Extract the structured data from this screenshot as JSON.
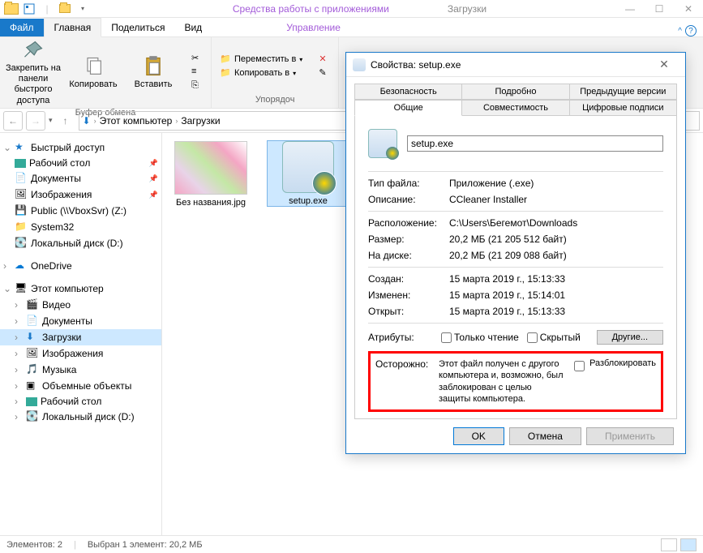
{
  "titlebar": {
    "context_tab": "Средства работы с приложениями",
    "location": "Загрузки"
  },
  "ribbon_tabs": {
    "file": "Файл",
    "home": "Главная",
    "share": "Поделиться",
    "view": "Вид",
    "manage": "Управление"
  },
  "ribbon": {
    "pin": "Закрепить на панели быстрого доступа",
    "copy": "Копировать",
    "paste": "Вставить",
    "clipboard_group": "Буфер обмена",
    "move_to": "Переместить в",
    "copy_to": "Копировать в",
    "organize_group": "Упорядоч"
  },
  "breadcrumb": {
    "root": "Этот компьютер",
    "current": "Загрузки"
  },
  "nav": {
    "quick": "Быстрый доступ",
    "desktop": "Рабочий стол",
    "documents": "Документы",
    "pictures": "Изображения",
    "public": "Public (\\\\VboxSvr) (Z:)",
    "system32": "System32",
    "localdisk": "Локальный диск (D:)",
    "onedrive": "OneDrive",
    "thispc": "Этот компьютер",
    "video": "Видео",
    "documents2": "Документы",
    "downloads": "Загрузки",
    "pictures2": "Изображения",
    "music": "Музыка",
    "objects3d": "Объемные объекты",
    "desktop2": "Рабочий стол",
    "localdisk2": "Локальный диск (D:)"
  },
  "files": {
    "img_name": "Без названия.jpg",
    "exe_name": "setup.exe"
  },
  "status": {
    "count": "Элементов: 2",
    "selection": "Выбран 1 элемент: 20,2 МБ"
  },
  "dialog": {
    "title": "Свойства: setup.exe",
    "tabs": {
      "security": "Безопасность",
      "details": "Подробно",
      "prev_versions": "Предыдущие версии",
      "general": "Общие",
      "compat": "Совместимость",
      "signatures": "Цифровые подписи"
    },
    "filename": "setup.exe",
    "type_lbl": "Тип файла:",
    "type_val": "Приложение (.exe)",
    "desc_lbl": "Описание:",
    "desc_val": "CCleaner Installer",
    "loc_lbl": "Расположение:",
    "loc_val": "C:\\Users\\Бегемот\\Downloads",
    "size_lbl": "Размер:",
    "size_val": "20,2 МБ (21 205 512 байт)",
    "disk_lbl": "На диске:",
    "disk_val": "20,2 МБ (21 209 088 байт)",
    "created_lbl": "Создан:",
    "created_val": "15 марта 2019 г., 15:13:33",
    "modified_lbl": "Изменен:",
    "modified_val": "15 марта 2019 г., 15:14:01",
    "opened_lbl": "Открыт:",
    "opened_val": "15 марта 2019 г., 15:13:33",
    "attr_lbl": "Атрибуты:",
    "readonly": "Только чтение",
    "hidden": "Скрытый",
    "other_btn": "Другие...",
    "warn_lbl": "Осторожно:",
    "warn_msg": "Этот файл получен с другого компьютера и, возможно, был заблокирован с целью защиты компьютера.",
    "unblock": "Разблокировать",
    "ok": "OK",
    "cancel": "Отмена",
    "apply": "Применить"
  }
}
